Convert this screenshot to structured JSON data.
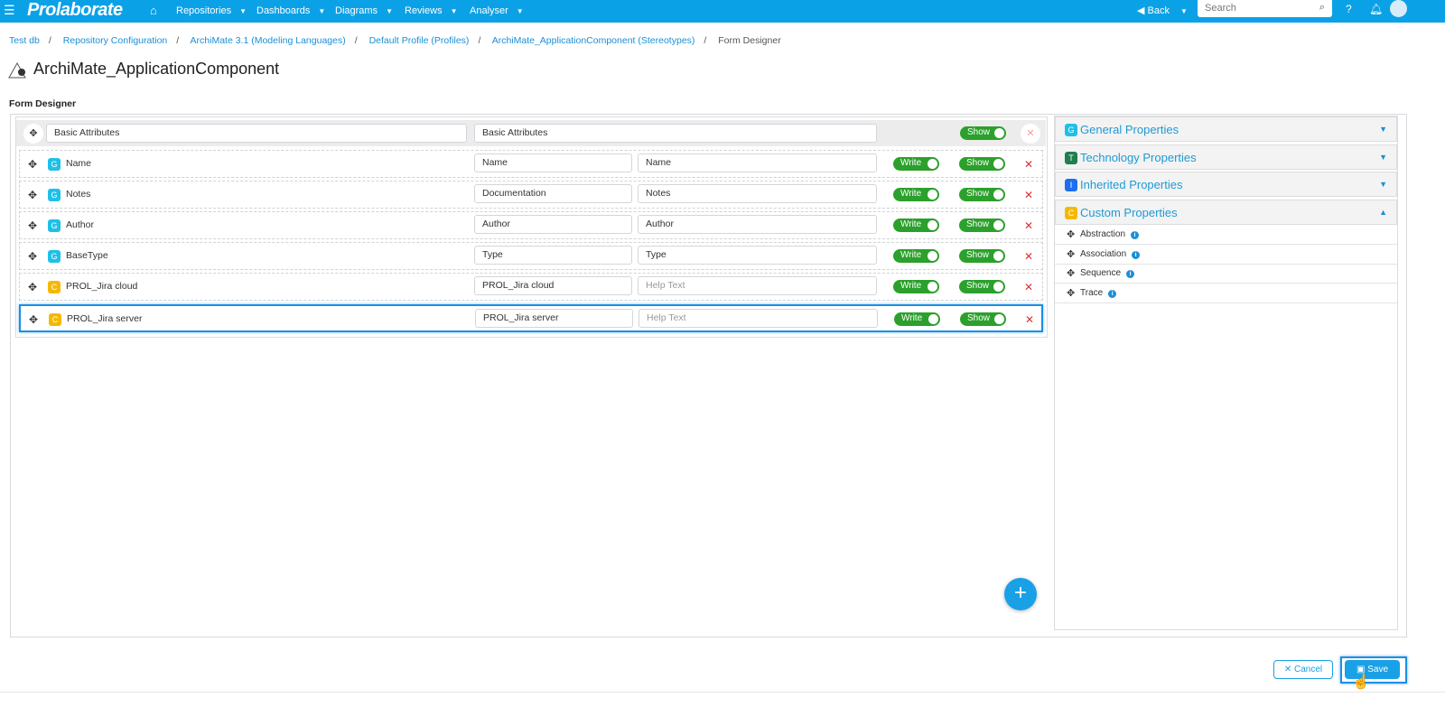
{
  "nav": {
    "logo": "Prolaborate",
    "items": [
      "Repositories",
      "Dashboards",
      "Diagrams",
      "Reviews",
      "Analyser"
    ],
    "back": "Back",
    "search_placeholder": "Search"
  },
  "breadcrumb": [
    "Test db",
    "Repository Configuration",
    "ArchiMate 3.1 (Modeling Languages)",
    "Default Profile (Profiles)",
    "ArchiMate_ApplicationComponent (Stereotypes)",
    "Form Designer"
  ],
  "page_title": "ArchiMate_ApplicationComponent",
  "section_label": "Form Designer",
  "group": {
    "name": "Basic Attributes",
    "display": "Basic Attributes",
    "show": "Show"
  },
  "rows": [
    {
      "badge": "G",
      "label": "Name",
      "alias": "Name",
      "help": "Name",
      "write": "Write",
      "show": "Show"
    },
    {
      "badge": "G",
      "label": "Notes",
      "alias": "Documentation",
      "help": "Notes",
      "write": "Write",
      "show": "Show"
    },
    {
      "badge": "G",
      "label": "Author",
      "alias": "Author",
      "help": "Author",
      "write": "Write",
      "show": "Show"
    },
    {
      "badge": "G",
      "label": "BaseType",
      "alias": "Type",
      "help": "Type",
      "write": "Write",
      "show": "Show"
    },
    {
      "badge": "C",
      "label": "PROL_Jira cloud",
      "alias": "PROL_Jira cloud",
      "help_placeholder": "Help Text",
      "write": "Write",
      "show": "Show"
    },
    {
      "badge": "C",
      "label": "PROL_Jira server",
      "alias": "PROL_Jira server",
      "help_placeholder": "Help Text",
      "write": "Write",
      "show": "Show"
    }
  ],
  "panels": [
    {
      "badge": "G",
      "title": "General Properties",
      "color": "#1ec0e8"
    },
    {
      "badge": "T",
      "title": "Technology Properties",
      "color": "#1f7f4f"
    },
    {
      "badge": "I",
      "title": "Inherited Properties",
      "color": "#1a6ff0"
    },
    {
      "badge": "C",
      "title": "Custom Properties",
      "color": "#f5b800"
    }
  ],
  "custom_properties": [
    "Abstraction",
    "Association",
    "Sequence",
    "Trace"
  ],
  "buttons": {
    "cancel": "Cancel",
    "save": "Save",
    "add": "+"
  }
}
